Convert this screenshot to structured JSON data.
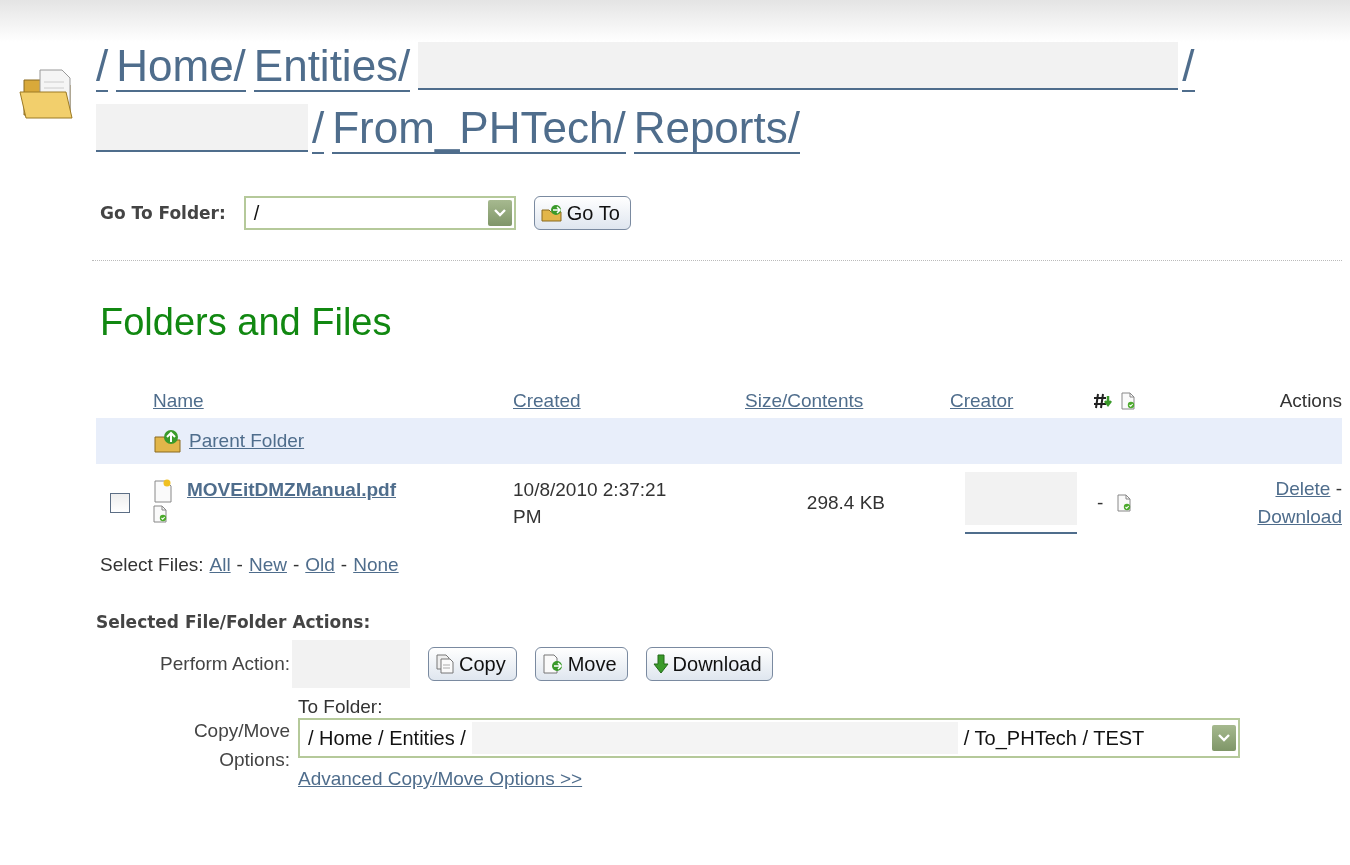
{
  "breadcrumb": [
    {
      "label": "/",
      "redacted": false
    },
    {
      "label": "Home/",
      "redacted": false
    },
    {
      "label": "Entities/",
      "redacted": false
    },
    {
      "label": "/",
      "redacted": true
    },
    {
      "label": "/",
      "redacted": true
    },
    {
      "label": "From_PHTech/",
      "redacted": false
    },
    {
      "label": "Reports/",
      "redacted": false
    }
  ],
  "go_to_folder": {
    "label": "Go To Folder:",
    "value": "/",
    "button": "Go To"
  },
  "section_title": "Folders and Files",
  "table": {
    "columns": [
      {
        "label": "Name",
        "kind": "link"
      },
      {
        "label": "Created",
        "kind": "link"
      },
      {
        "label": "Size/Contents",
        "kind": "link"
      },
      {
        "label": "Creator",
        "kind": "link"
      },
      {
        "kind": "icons"
      },
      {
        "label": "Actions",
        "kind": "text"
      }
    ],
    "parent_row": {
      "label": "Parent Folder"
    },
    "rows": [
      {
        "checked": false,
        "name": "MOVEitDMZManual.pdf",
        "created": "10/8/2010 2:37:21 PM",
        "size": "298.4 KB",
        "creator_redacted": true,
        "count": "-",
        "actions": [
          "Delete",
          "Download"
        ]
      }
    ],
    "separator": "-"
  },
  "select_files": {
    "label": "Select Files:",
    "links": [
      "All",
      "New",
      "Old",
      "None"
    ],
    "separator": "-"
  },
  "actions": {
    "title": "Selected File/Folder Actions:",
    "perform_label": "Perform Action:",
    "buttons": [
      {
        "label": "Copy"
      },
      {
        "label": "Move"
      },
      {
        "label": "Download"
      }
    ],
    "options_label": "Copy/Move Options:",
    "to_folder_label": "To Folder:",
    "to_folder_value_start": "/ Home / Entities /",
    "to_folder_value_end": "/ To_PHTech / TEST",
    "advanced_link": "Advanced Copy/Move Options >>"
  }
}
